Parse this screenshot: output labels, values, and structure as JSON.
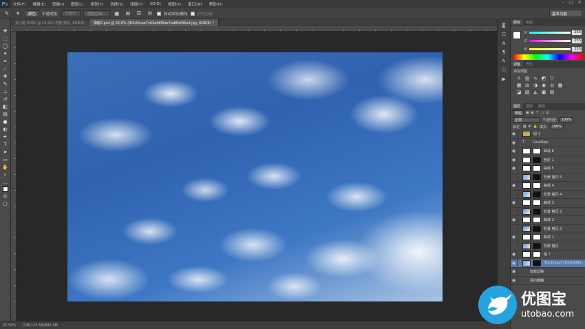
{
  "app": {
    "logo": "Ps"
  },
  "menu": [
    "文件(F)",
    "编辑(E)",
    "图像(I)",
    "图层(L)",
    "类型(Y)",
    "选择(S)",
    "滤镜(T)",
    "3D(D)",
    "视图(V)",
    "窗口(W)",
    "帮助(H)"
  ],
  "options": {
    "brush_mode": "颜色",
    "opacity_label": "不透明度:",
    "opacity_value": "100%",
    "refine_btn": "调整边缘...",
    "autoselect_label": "自动添加/删除",
    "align_label": "对齐边缘"
  },
  "workspace": "基本功能",
  "tabs": [
    {
      "label": "天心路 HDR2 @ 14.9% (背景 拷贝, RGB/8)",
      "active": false
    },
    {
      "label": "相册2.psd @ 22.6% (f82cfbcae7c63afd06de7ad8fef06ed.jpg, RGB/8) *",
      "active": true
    }
  ],
  "status": {
    "zoom": "22.59%",
    "doc": "文档:113.5M/806.3M"
  },
  "color_panel": {
    "tabs": [
      "颜色",
      "色板"
    ],
    "r": "255",
    "g": "255",
    "b": "255"
  },
  "adjust_panel": {
    "tabs": [
      "调整",
      "样式"
    ],
    "title": "添加调整"
  },
  "layers_panel": {
    "tabs": [
      "图层",
      "通道",
      "路径"
    ],
    "kind_label": "类型",
    "blend_mode": "正常",
    "opacity_label": "不透明度:",
    "opacity_value": "100%",
    "lock_label": "锁定:",
    "fill_label": "填充:",
    "fill_value": "100%",
    "layers": [
      {
        "name": "组 1",
        "type": "group",
        "visible": true
      },
      {
        "name": "LineDojo",
        "type": "text",
        "visible": true
      },
      {
        "name": "曲线 6",
        "type": "adjust",
        "visible": true
      },
      {
        "name": "色阶 1",
        "type": "adjust",
        "visible": true
      },
      {
        "name": "曲线 5",
        "type": "adjust",
        "visible": true
      },
      {
        "name": "背景 拷贝 5",
        "type": "image",
        "visible": false
      },
      {
        "name": "曲线 4",
        "type": "adjust",
        "visible": true
      },
      {
        "name": "背景 拷贝 4",
        "type": "image",
        "visible": false
      },
      {
        "name": "曲线 3",
        "type": "adjust",
        "visible": true
      },
      {
        "name": "背景 拷贝 3",
        "type": "image",
        "visible": false
      },
      {
        "name": "曲线 2",
        "type": "adjust",
        "visible": true
      },
      {
        "name": "背景 拷贝 2",
        "type": "image",
        "visible": false
      },
      {
        "name": "曲线 1",
        "type": "adjust",
        "visible": true
      },
      {
        "name": "背景 拷贝",
        "type": "image",
        "visible": false
      },
      {
        "name": "组 7",
        "type": "adjust",
        "visible": true
      },
      {
        "name": "f82cfbcae7c63afd06d...",
        "type": "image",
        "visible": true,
        "selected": true
      },
      {
        "name": "智能滤镜",
        "type": "filter",
        "visible": true
      },
      {
        "name": "径向模糊",
        "type": "filter",
        "visible": true
      }
    ]
  },
  "watermark": {
    "cn": "优图宝",
    "en": "utobao.com"
  }
}
